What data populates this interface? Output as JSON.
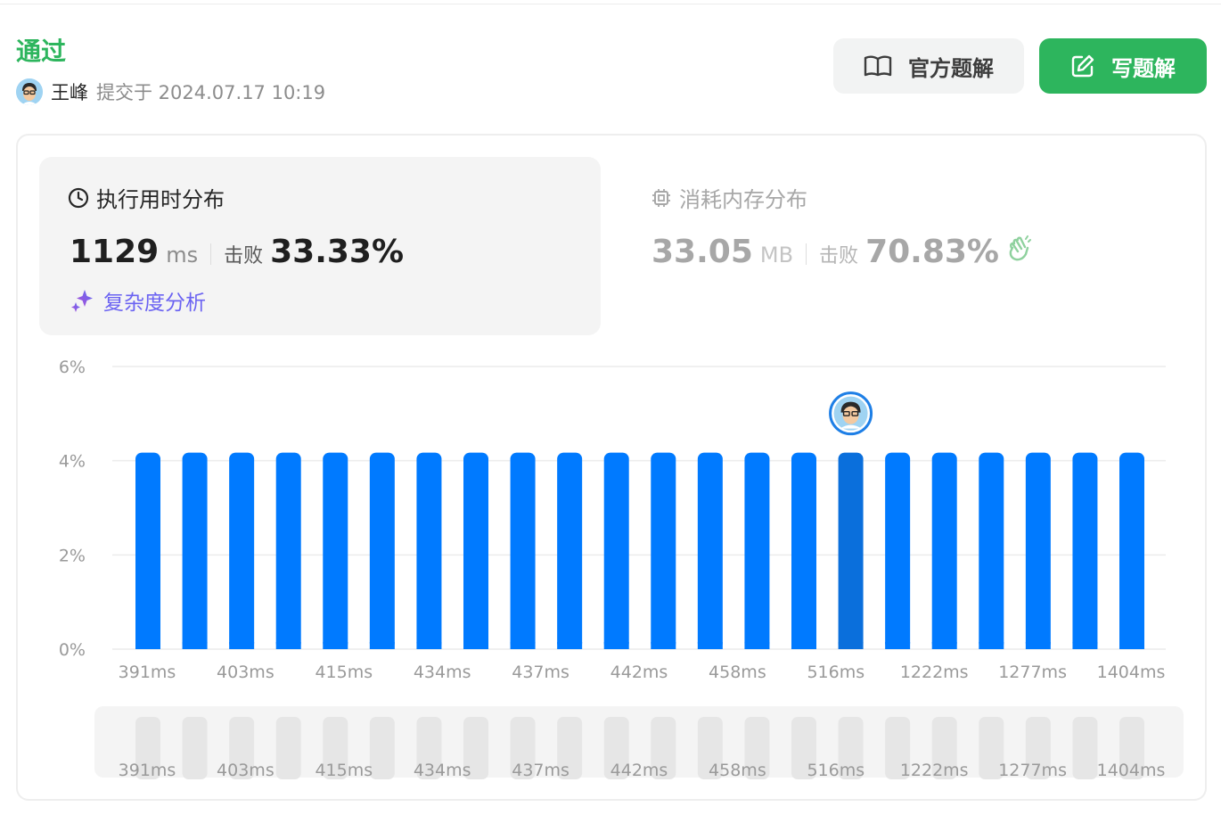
{
  "submission": {
    "status": "通过",
    "user_name": "王峰",
    "submitted_at": "提交于 2024.07.17 10:19"
  },
  "buttons": {
    "official": "官方题解",
    "write": "写题解"
  },
  "runtime_card": {
    "title": "执行用时分布",
    "value": "1129",
    "unit": "ms",
    "beat_label": "击败",
    "beat_value": "33.33%",
    "complexity_link": "复杂度分析"
  },
  "memory_card": {
    "title": "消耗内存分布",
    "value": "33.05",
    "unit": "MB",
    "beat_label": "击败",
    "beat_value": "70.83%"
  },
  "colors": {
    "accent_green": "#2db55d",
    "bar_blue": "#007aff",
    "bar_highlight": "#0a6fdc",
    "mini_bar": "#e6e6e6",
    "purple": "#6b63f2"
  },
  "icons": [
    "book-icon",
    "edit-icon",
    "clock-icon",
    "chip-icon",
    "clap-icon",
    "sparkle-icon"
  ],
  "chart_data": {
    "type": "bar",
    "ylim": [
      0,
      6
    ],
    "ytick_labels": [
      "0%",
      "2%",
      "4%",
      "6%"
    ],
    "values": [
      4.17,
      4.17,
      4.17,
      4.17,
      4.17,
      4.17,
      4.17,
      4.17,
      4.17,
      4.17,
      4.17,
      4.17,
      4.17,
      4.17,
      4.17,
      4.17,
      4.17,
      4.17,
      4.17,
      4.17,
      4.17,
      4.17
    ],
    "highlight_index": 15,
    "xtick_labels": [
      "391ms",
      "403ms",
      "415ms",
      "434ms",
      "437ms",
      "442ms",
      "458ms",
      "516ms",
      "1222ms",
      "1277ms",
      "1404ms"
    ],
    "grid": true
  }
}
